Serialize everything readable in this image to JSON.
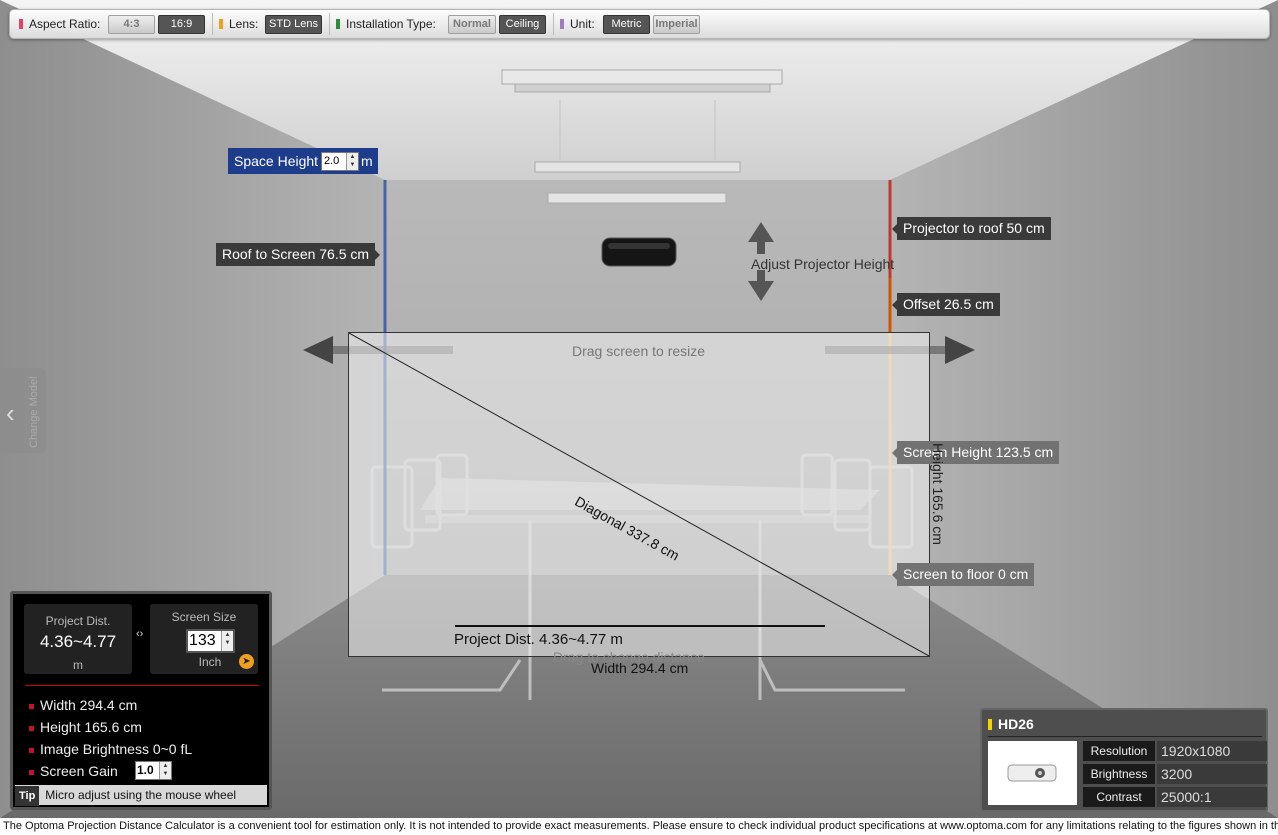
{
  "toolbar": {
    "aspect_label": "Aspect Ratio:",
    "aspect_43": "4:3",
    "aspect_169": "16:9",
    "lens_label": "Lens:",
    "lens_value": "STD Lens",
    "install_label": "Installation Type:",
    "install_normal": "Normal",
    "install_ceiling": "Ceiling",
    "unit_label": "Unit:",
    "unit_metric": "Metric",
    "unit_imperial": "Imperial",
    "colors": {
      "aspect": "#e0406a",
      "lens": "#f0a020",
      "install": "#2e8b3a",
      "unit": "#9a7fc0"
    }
  },
  "scene": {
    "space_height_label": "Space Height",
    "space_height_value": "2.0",
    "space_height_unit": "m",
    "roof_to_screen": "Roof to Screen 76.5 cm",
    "projector_to_roof": "Projector to roof 50 cm",
    "offset": "Offset 26.5  cm",
    "adjust_height": "Adjust Projector Height",
    "drag_resize": "Drag screen to resize",
    "screen_height": "Screen Height 123.5 cm",
    "height_vertical": "Height 165.6 cm",
    "screen_to_floor": "Screen to floor 0 cm",
    "diagonal": "Diagonal 337.8 cm",
    "project_dist": "Project Dist. 4.36~4.77 m",
    "drag_distance": "Drag to change distance",
    "width": "Width 294.4 cm",
    "change_model": "Change Model"
  },
  "calc": {
    "project_dist_label": "Project Dist.",
    "project_dist_value": "4.36~4.77",
    "project_dist_unit": "m",
    "screen_size_label": "Screen Size",
    "screen_size_value": "133",
    "screen_size_unit": "Inch",
    "width": "Width 294.4 cm",
    "height": "Height 165.6 cm",
    "brightness": "Image Brightness 0~0 fL",
    "gain_label": "Screen Gain",
    "gain_value": "1.0",
    "tip_label": "Tip",
    "tip_text": "Micro adjust using the mouse wheel"
  },
  "model": {
    "name": "HD26",
    "resolution_label": "Resolution",
    "resolution_value": "1920x1080",
    "brightness_label": "Brightness",
    "brightness_value": "3200",
    "contrast_label": "Contrast",
    "contrast_value": "25000:1"
  },
  "footer": {
    "text": "The Optoma Projection Distance Calculator is a convenient tool for estimation only. It is not intended to provide exact measurements. Please ensure to check individual product specifications at www.optoma.com for any limitations relating to the figures shown in this"
  }
}
